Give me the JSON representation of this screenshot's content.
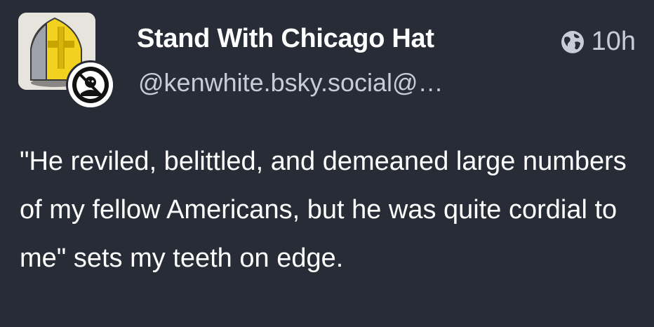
{
  "account": {
    "display_name": "Stand With Chicago Hat",
    "handle": "@kenwhite.bsky.social@…",
    "avatar_icon": "mitre-hat-icon",
    "bridge_badge_icon": "bridge-badge-icon"
  },
  "meta": {
    "visibility_icon": "globe-icon",
    "relative_time": "10h"
  },
  "status": {
    "text": "\"He reviled, belittled, and demeaned large numbers of my fellow Americans, but he was quite cordial to me\" sets my teeth on edge."
  },
  "colors": {
    "background": "#282c37",
    "primary_text": "#ffffff",
    "secondary_text": "#c8ccd8",
    "mitre_yellow": "#f2d21f"
  }
}
